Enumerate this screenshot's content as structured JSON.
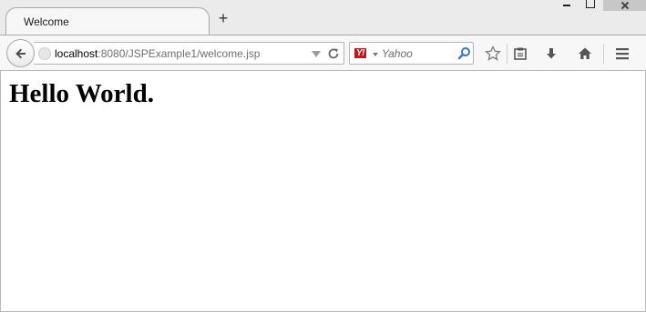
{
  "window": {
    "tab_title": "Welcome",
    "new_tab_symbol": "+"
  },
  "navbar": {
    "url_host": "localhost",
    "url_rest": ":8080/JSPExample1/welcome.jsp",
    "search_engine": "Y!",
    "search_placeholder": "Yahoo"
  },
  "page": {
    "heading": "Hello World."
  },
  "icons": {
    "back": "back-arrow-icon",
    "site_identity": "globe-icon",
    "history_dropdown": "triangle-down-icon",
    "reload": "reload-icon",
    "search": "magnifier-icon",
    "bookmark": "star-icon",
    "reading_list": "clipboard-icon",
    "downloads": "download-arrow-icon",
    "home": "house-icon",
    "menu": "hamburger-icon"
  },
  "colors": {
    "yahoo_red": "#c41717",
    "search_icon_blue": "#3a78c4",
    "toolbar_bg": "#f7f7f7"
  }
}
